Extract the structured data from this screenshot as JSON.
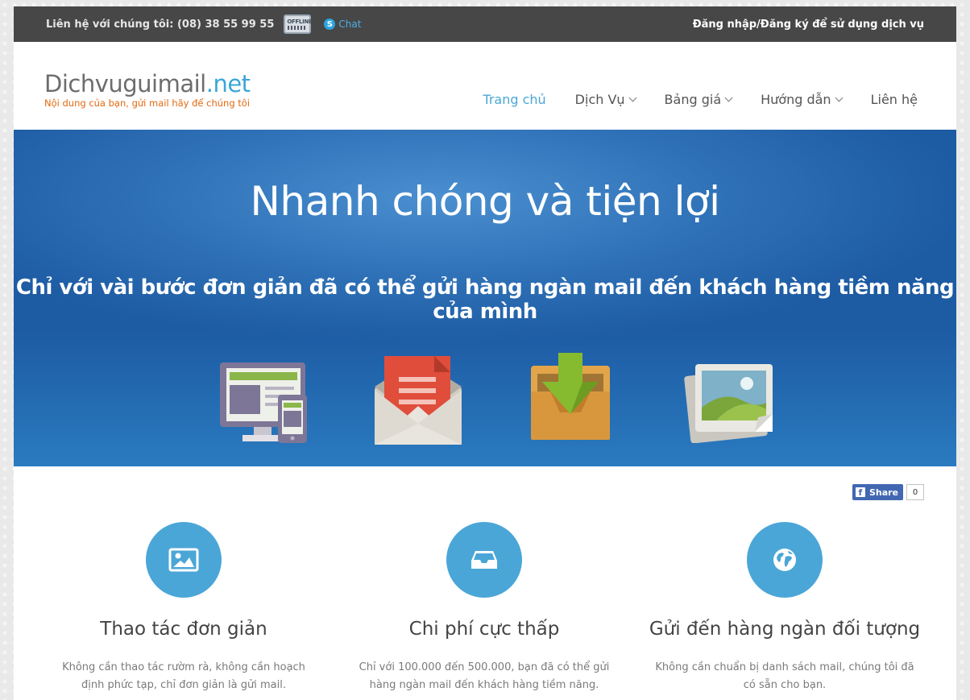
{
  "topbar": {
    "contact": "Liên hệ với chúng tôi: (08) 38 55 99 55",
    "offline_badge": "OFFLINE",
    "chat": "Chat",
    "login": "Đăng nhập/Đăng ký để sử dụng dịch vụ"
  },
  "logo": {
    "main": "Dichvuguimail",
    "suffix": ".net",
    "tagline": "Nội dung của bạn, gửi mail hãy để chúng tôi"
  },
  "nav": {
    "items": [
      {
        "label": "Trang chủ",
        "dropdown": false,
        "active": true
      },
      {
        "label": "Dịch Vụ",
        "dropdown": true,
        "active": false
      },
      {
        "label": "Bảng giá",
        "dropdown": true,
        "active": false
      },
      {
        "label": "Hướng dẫn",
        "dropdown": true,
        "active": false
      },
      {
        "label": "Liên hệ",
        "dropdown": false,
        "active": false
      }
    ]
  },
  "hero": {
    "title": "Nhanh chóng và tiện lợi",
    "subtitle": "Chỉ với vài bước đơn giản đã có thể gửi hàng ngàn mail đến khách hàng tiềm năng của mình",
    "icons": [
      "devices-icon",
      "mail-envelope-icon",
      "inbox-download-icon",
      "photos-icon"
    ]
  },
  "share": {
    "label": "Share",
    "count": "0"
  },
  "features": [
    {
      "icon": "image-icon",
      "title": "Thao tác đơn giản",
      "desc": "Không cần thao tác rườm rà, không cần hoạch định phức tạp, chỉ đơn giản là gửi mail."
    },
    {
      "icon": "inbox-icon",
      "title": "Chi phí cực thấp",
      "desc": "Chỉ với 100.000 đến 500.000, bạn đã có thể gửi hàng ngàn mail đến khách hàng tiềm năng."
    },
    {
      "icon": "globe-icon",
      "title": "Gửi đến hàng ngàn đối tượng",
      "desc": "Không cần chuẩn bị danh sách mail, chúng tôi đã có sẵn cho bạn."
    }
  ],
  "colors": {
    "accent": "#4aa6d7",
    "topbar": "#474747",
    "logo_accent": "#3aa6d8",
    "tagline": "#e2690f",
    "hero": "#2e70b6"
  }
}
